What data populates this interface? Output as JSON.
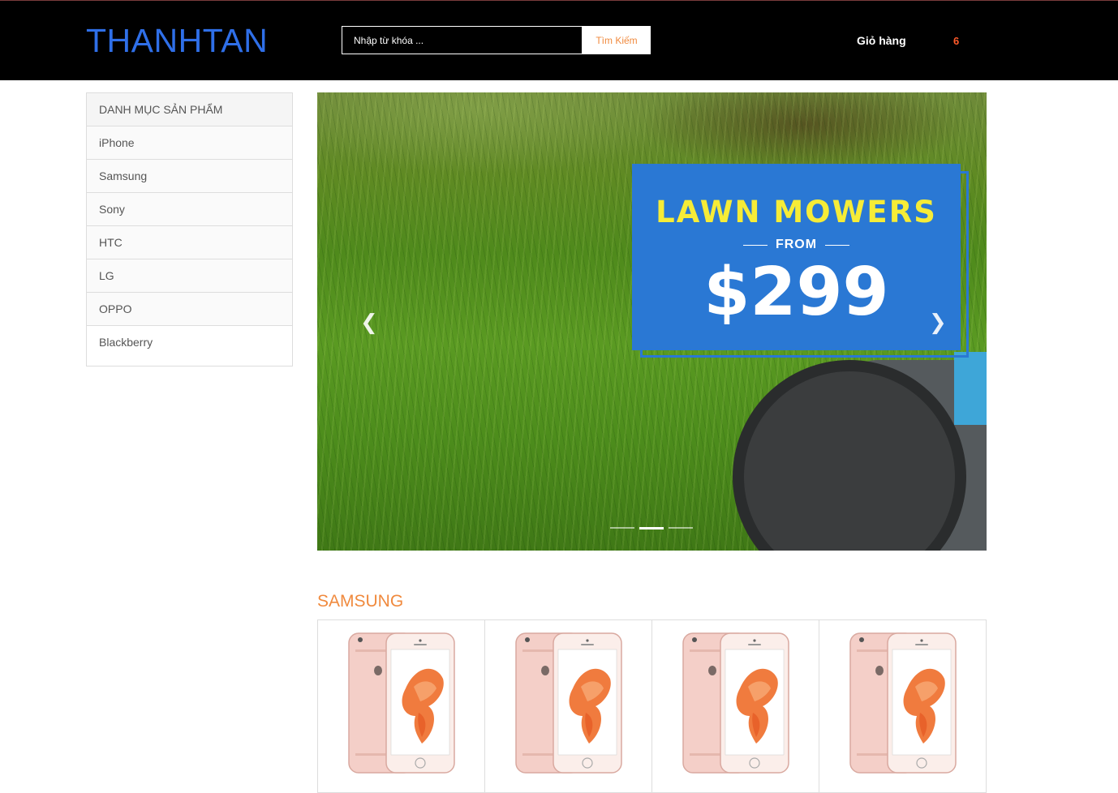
{
  "header": {
    "logo": "THANHTAN",
    "search_placeholder": "Nhập từ khóa ...",
    "search_button": "Tìm Kiếm",
    "cart_label": "Giỏ hàng",
    "cart_count": "6"
  },
  "sidebar": {
    "title": "DANH MỤC SẢN PHẨM",
    "items": [
      "iPhone",
      "Samsung",
      "Sony",
      "HTC",
      "LG",
      "OPPO",
      "Blackberry"
    ]
  },
  "slider": {
    "promo_title": "LAWN MOWERS",
    "promo_from": "FROM",
    "promo_price": "$299",
    "prev_icon": "chevron-left-icon",
    "next_icon": "chevron-right-icon",
    "slide_count": 3,
    "active_slide": 2
  },
  "section": {
    "title": "SAMSUNG",
    "products": [
      {
        "image": "iphone-rose-gold"
      },
      {
        "image": "iphone-rose-gold"
      },
      {
        "image": "iphone-rose-gold"
      },
      {
        "image": "iphone-rose-gold"
      }
    ]
  },
  "colors": {
    "header_bg": "#000000",
    "logo": "#2f6fe8",
    "accent": "#f08a3e",
    "cart_count": "#ff5a2a",
    "promo_bg": "#2a78d4",
    "promo_title": "#f6ec37"
  }
}
